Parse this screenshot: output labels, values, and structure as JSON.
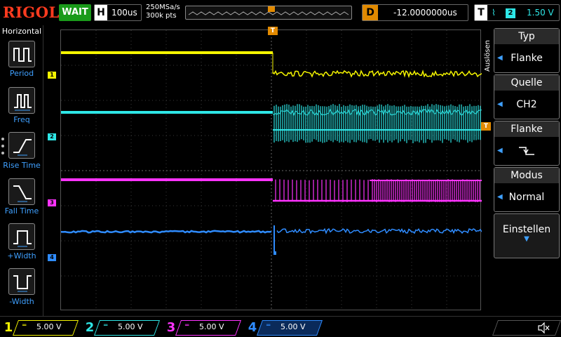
{
  "brand": {
    "logo": "RIGOL"
  },
  "status": {
    "run_state": "WAIT"
  },
  "horizontal": {
    "letter": "H",
    "timebase": "100us",
    "sample_rate": "250MSa/s",
    "memory_depth": "300k pts"
  },
  "delay": {
    "letter": "D",
    "value": "-12.0000000us"
  },
  "trigger": {
    "letter": "T",
    "edge_symbol": "⌇",
    "source_channel": "2",
    "level": "1.50 V",
    "marker": "T"
  },
  "left_menu": {
    "title": "Horizontal",
    "items": [
      {
        "label": "Period"
      },
      {
        "label": "Freq"
      },
      {
        "label": "Rise Time"
      },
      {
        "label": "Fall Time"
      },
      {
        "label": "+Width"
      },
      {
        "label": "-Width"
      }
    ]
  },
  "right_menu": {
    "side_label": "Auslösen",
    "sections": [
      {
        "title": "Typ",
        "value": "Flanke"
      },
      {
        "title": "Quelle",
        "value": "CH2"
      },
      {
        "title": "Flanke",
        "value": ""
      },
      {
        "title": "Modus",
        "value": "Normal"
      }
    ],
    "action": {
      "label": "Einstellen"
    }
  },
  "channels": [
    {
      "num": "1",
      "coupling": "═",
      "scale": "5.00 V",
      "color": "#f5f500"
    },
    {
      "num": "2",
      "coupling": "═",
      "scale": "5.00 V",
      "color": "#2ee6e6"
    },
    {
      "num": "3",
      "coupling": "═",
      "scale": "5.00 V",
      "color": "#ff33ff"
    },
    {
      "num": "4",
      "coupling": "═",
      "scale": "5.00 V",
      "color": "#2f8cff"
    }
  ],
  "colors": {
    "trigger_orange": "#e28a00",
    "accent_blue": "#3fa0ff",
    "grid": "#3a3a3a"
  },
  "icons": {
    "volume": "speaker-muted-icon"
  }
}
